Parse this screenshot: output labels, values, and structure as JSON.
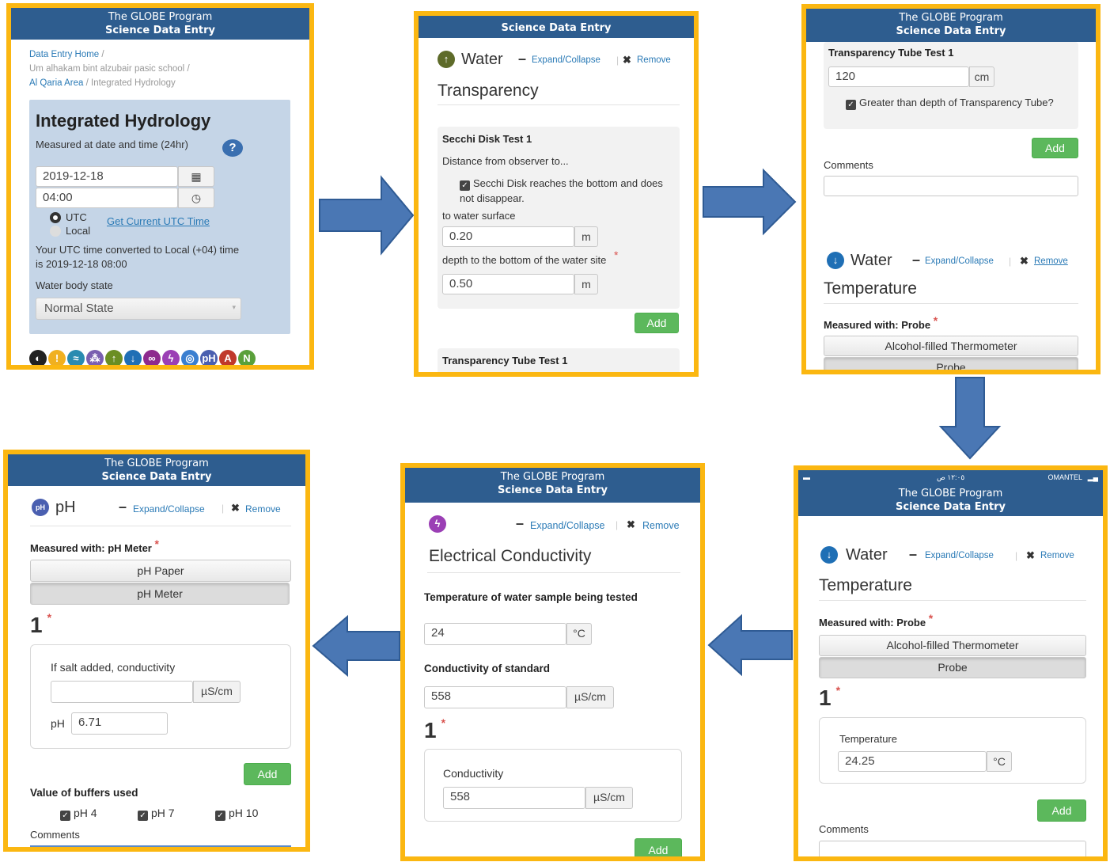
{
  "colors": {
    "border": "#fbb711",
    "header": "#2e5d8f",
    "arrow": "#4a77b4",
    "add": "#5cb85c",
    "link": "#2a7ab6"
  },
  "header": {
    "line1": "The GLOBE Program",
    "line2": "Science Data Entry"
  },
  "panel1": {
    "breadcrumb": {
      "home": "Data Entry Home",
      "sep": "/",
      "school": "Um alhakam bint alzubair pasic school",
      "area": "Al Qaria Area",
      "page": "Integrated Hydrology"
    },
    "title": "Integrated Hydrology",
    "measured_label": "Measured at date and time (24hr)",
    "date": "2019-12-18",
    "time": "04:00",
    "utc": "UTC",
    "local": "Local",
    "get_utc": "Get Current UTC Time",
    "converted": "Your UTC time converted to Local (+04) time is 2019-12-18 08:00",
    "water_state_label": "Water body state",
    "water_state_value": "Normal State"
  },
  "panel2": {
    "section": "Water",
    "expand": "Expand/Collapse",
    "remove": "Remove",
    "heading": "Transparency",
    "test_title": "Secchi Disk Test 1",
    "distance_label": "Distance from observer to...",
    "checkbox_label": "Secchi Disk reaches the bottom and does not disappear.",
    "surface_label": "to water surface",
    "surface_value": "0.20",
    "unit_m": "m",
    "depth_label": "depth to the bottom of the water site",
    "depth_value": "0.50",
    "add": "Add",
    "tube_title": "Transparency Tube Test 1"
  },
  "panel3": {
    "tube_title": "Transparency Tube Test 1",
    "tube_value": "120",
    "unit_cm": "cm",
    "checkbox_label": "Greater than depth of Transparency Tube?",
    "add": "Add",
    "comments": "Comments",
    "section": "Water",
    "expand": "Expand/Collapse",
    "remove": "Remove",
    "heading": "Temperature",
    "measured_with": "Measured with: Probe",
    "opt1": "Alcohol-filled Thermometer",
    "opt2": "Probe"
  },
  "panel4": {
    "status_carrier": "OMANTEL",
    "status_time": "١٢:٠٥ ص",
    "section": "Water",
    "expand": "Expand/Collapse",
    "remove": "Remove",
    "heading": "Temperature",
    "measured_with": "Measured with: Probe",
    "opt1": "Alcohol-filled Thermometer",
    "opt2": "Probe",
    "num": "1",
    "temp_label": "Temperature",
    "temp_value": "24.25",
    "unit_c": "°C",
    "add": "Add",
    "comments": "Comments"
  },
  "panel5": {
    "expand": "Expand/Collapse",
    "remove": "Remove",
    "heading": "Electrical Conductivity",
    "temp_label": "Temperature of water sample being tested",
    "temp_value": "24",
    "unit_c": "°C",
    "std_label": "Conductivity of standard",
    "std_value": "558",
    "unit_us": "µS/cm",
    "num": "1",
    "cond_label": "Conductivity",
    "cond_value": "558",
    "add": "Add"
  },
  "panel6": {
    "section": "pH",
    "expand": "Expand/Collapse",
    "remove": "Remove",
    "measured_with": "Measured with: pH Meter",
    "opt1": "pH Paper",
    "opt2": "pH Meter",
    "num": "1",
    "salt_label": "If salt added, conductivity",
    "unit_us": "µS/cm",
    "ph_label": "pH",
    "ph_value": "6.71",
    "add": "Add",
    "buffers_label": "Value of buffers used",
    "buf1": "pH 4",
    "buf2": "pH 7",
    "buf3": "pH 10",
    "comments": "Comments"
  }
}
